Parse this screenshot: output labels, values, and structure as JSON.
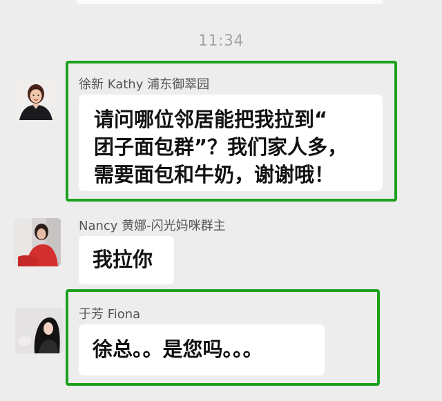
{
  "timestamp": "11:34",
  "highlight_color": "#1da01d",
  "messages": [
    {
      "sender": "徐新 Kathy 浦东御翠园",
      "avatar_icon": "woman-portrait-avatar",
      "lines": [
        "请问哪位邻居能把我拉到“",
        "团子面包群”？我们家人多，",
        "需要面包和牛奶，谢谢哦！"
      ],
      "highlighted": true
    },
    {
      "sender": "Nancy 黄娜-闪光妈咪群主",
      "avatar_icon": "woman-red-dress-avatar",
      "lines": [
        "我拉你"
      ],
      "highlighted": false
    },
    {
      "sender": "于芳 Fiona",
      "avatar_icon": "woman-dark-hair-avatar",
      "lines": [
        "徐总。。是您吗。。。"
      ],
      "highlighted": true
    }
  ]
}
